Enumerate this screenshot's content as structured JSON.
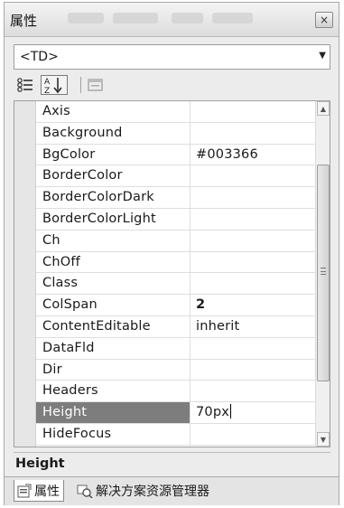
{
  "window": {
    "title": "属性",
    "close_label": "×"
  },
  "selector": {
    "value": "<TD>"
  },
  "toolbar": {
    "buttons": [
      {
        "icon": "categorized-icon"
      },
      {
        "icon": "sort-alphabetical-icon",
        "label": "A Z"
      },
      {
        "icon": "property-pages-icon"
      }
    ]
  },
  "properties": [
    {
      "name": "Axis",
      "value": ""
    },
    {
      "name": "Background",
      "value": ""
    },
    {
      "name": "BgColor",
      "value": "#003366"
    },
    {
      "name": "BorderColor",
      "value": ""
    },
    {
      "name": "BorderColorDark",
      "value": ""
    },
    {
      "name": "BorderColorLight",
      "value": ""
    },
    {
      "name": "Ch",
      "value": ""
    },
    {
      "name": "ChOff",
      "value": ""
    },
    {
      "name": "Class",
      "value": ""
    },
    {
      "name": "ColSpan",
      "value": "2"
    },
    {
      "name": "ContentEditable",
      "value": "inherit"
    },
    {
      "name": "DataFld",
      "value": ""
    },
    {
      "name": "Dir",
      "value": ""
    },
    {
      "name": "Headers",
      "value": ""
    },
    {
      "name": "Height",
      "value": "70px"
    },
    {
      "name": "HideFocus",
      "value": ""
    }
  ],
  "description": {
    "title": "Height"
  },
  "tabs": [
    {
      "label": "属性",
      "icon": "properties-icon",
      "active": true
    },
    {
      "label": "解决方案资源管理器",
      "icon": "solution-explorer-icon",
      "active": false
    }
  ],
  "colors": {
    "selected_row": "#7d7d7d",
    "grid_border": "#a0a0a0"
  }
}
